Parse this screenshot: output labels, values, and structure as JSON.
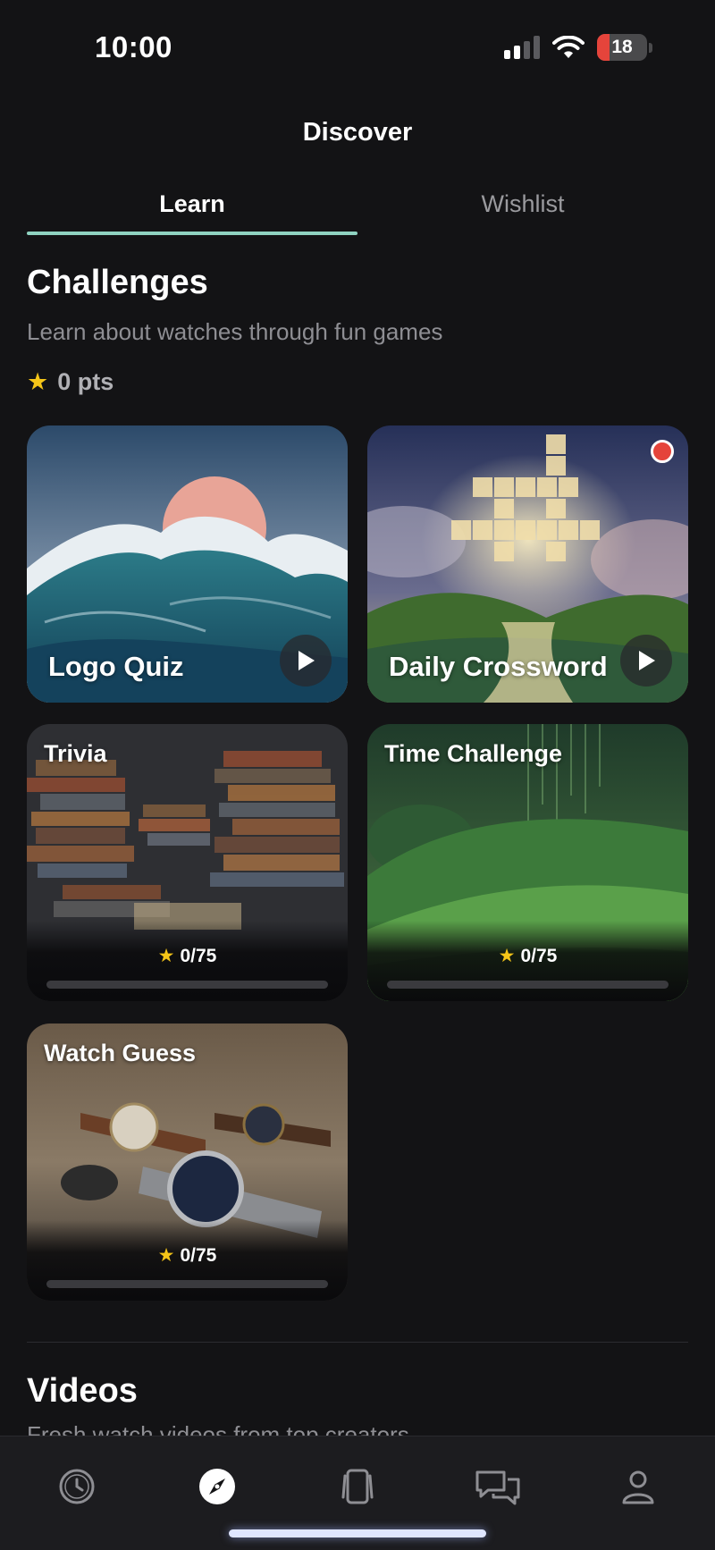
{
  "status_bar": {
    "time": "10:00",
    "battery": "18",
    "signal_bars": 2,
    "wifi_icon": "wifi-icon"
  },
  "header": {
    "title": "Discover"
  },
  "tabs": [
    {
      "label": "Learn",
      "active": true
    },
    {
      "label": "Wishlist",
      "active": false
    }
  ],
  "challenges": {
    "title": "Challenges",
    "subtitle": "Learn about watches through fun games",
    "points": "0 pts",
    "cards": [
      {
        "title": "Logo Quiz",
        "action_icon": "play-icon"
      },
      {
        "title": "Daily Crossword",
        "action_icon": "play-icon",
        "has_notification": true
      },
      {
        "title": "Trivia",
        "progress_text": "0/75",
        "progress": 0
      },
      {
        "title": "Time Challenge",
        "progress_text": "0/75",
        "progress": 0
      },
      {
        "title": "Watch Guess",
        "progress_text": "0/75",
        "progress": 0
      }
    ]
  },
  "videos": {
    "title": "Videos",
    "subtitle": "Fresh watch videos from top creators"
  },
  "bottom_nav": [
    {
      "icon": "watch-icon",
      "active": false
    },
    {
      "icon": "compass-icon",
      "active": true
    },
    {
      "icon": "cards-icon",
      "active": false
    },
    {
      "icon": "chat-icon",
      "active": false
    },
    {
      "icon": "profile-icon",
      "active": false
    }
  ],
  "colors": {
    "accent": "#8fd3c1",
    "background": "#131315",
    "star": "#f5c518",
    "notification": "#e5443b"
  }
}
